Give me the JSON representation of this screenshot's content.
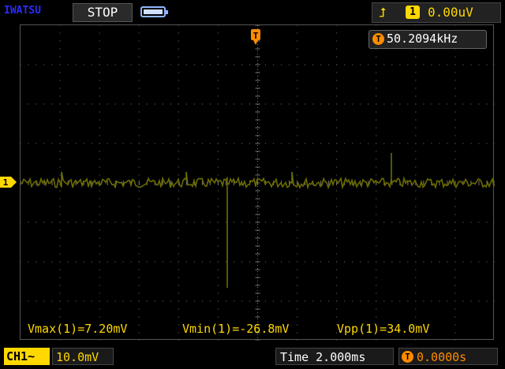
{
  "header": {
    "brand": "IWATSU",
    "run_state": "STOP",
    "battery_icon": "battery-icon",
    "trigger": {
      "edge_icon": "rising-edge-icon",
      "source": "1",
      "level": "0.00uV"
    }
  },
  "frequency": {
    "icon": "T",
    "value": "50.2094kHz"
  },
  "markers": {
    "trigger": "T",
    "channel": "1"
  },
  "measurements": [
    {
      "label": "Vmax(1)=7.20mV"
    },
    {
      "label": "Vmin(1)=-26.8mV"
    },
    {
      "label": "Vpp(1)=34.0mV"
    }
  ],
  "footer": {
    "channel_label": "CH1",
    "coupling_symbol": "~",
    "volts_per_div": "10.0mV",
    "time_label": "Time",
    "time_per_div": "2.000ms",
    "trigger_offset_icon": "T→",
    "trigger_offset": "0.0000s"
  },
  "colors": {
    "trace": "#6b6b00",
    "trigger": "#ff8c00",
    "channel": "#ffd800",
    "grid": "#777777"
  }
}
